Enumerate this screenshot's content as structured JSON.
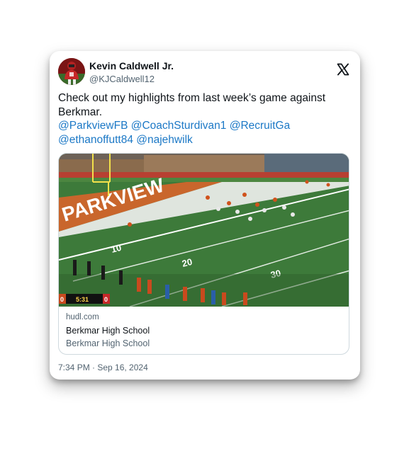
{
  "author": {
    "display_name": "Kevin Caldwell Jr.",
    "handle": "@KJCaldwell12"
  },
  "platform_icon": "x-logo-icon",
  "tweet": {
    "text": "Check out my highlights from last week’s game against Berkmar.",
    "mentions": [
      "@ParkviewFB",
      "@CoachSturdivan1",
      "@RecruitGa",
      "@ethanoffutt84",
      "@najehwilk"
    ]
  },
  "media": {
    "field": {
      "endzone_text": "PARKVIEW",
      "yard_numbers": [
        "10",
        "20",
        "30"
      ],
      "scoreboard": {
        "left": "0",
        "clock": "5:31",
        "right": "0"
      }
    },
    "link_domain": "hudl.com",
    "link_title": "Berkmar High School",
    "link_description": "Berkmar High School"
  },
  "timestamp": "7:34 PM · Sep 16, 2024",
  "colors": {
    "link": "#1b78c6",
    "secondary_text": "#536471",
    "border": "#cfd9de"
  }
}
